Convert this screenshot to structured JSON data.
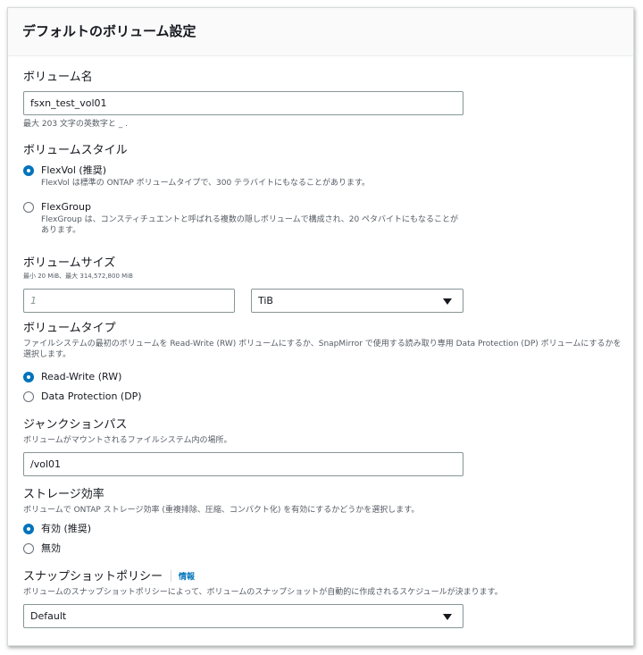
{
  "panel": {
    "title": "デフォルトのボリューム設定"
  },
  "volume_name": {
    "label": "ボリューム名",
    "value": "fsxn_test_vol01",
    "hint": "最大 203 文字の英数字と _ ."
  },
  "volume_style": {
    "label": "ボリュームスタイル",
    "options": [
      {
        "label": "FlexVol (推奨)",
        "description": "FlexVol は標準の ONTAP ボリュームタイプで、300 テラバイトにもなることがあります。",
        "selected": true
      },
      {
        "label": "FlexGroup",
        "description": "FlexGroup は、コンスティチュエントと呼ばれる複数の隠しボリュームで構成され、20 ペタバイトにもなることがあります。",
        "selected": false
      }
    ]
  },
  "volume_size": {
    "label": "ボリュームサイズ",
    "hint": "最小 20 MiB、最大 314,572,800 MiB",
    "placeholder": "1",
    "unit": "TiB"
  },
  "volume_type": {
    "label": "ボリュームタイプ",
    "description": "ファイルシステムの最初のボリュームを Read-Write (RW) ボリュームにするか、SnapMirror で使用する読み取り専用 Data Protection (DP) ボリュームにするかを選択します。",
    "options": [
      {
        "label": "Read-Write (RW)",
        "selected": true
      },
      {
        "label": "Data Protection (DP)",
        "selected": false
      }
    ]
  },
  "junction_path": {
    "label": "ジャンクションパス",
    "hint": "ボリュームがマウントされるファイルシステム内の場所。",
    "value": "/vol01"
  },
  "storage_efficiency": {
    "label": "ストレージ効率",
    "hint": "ボリュームで ONTAP ストレージ効率 (重複排除、圧縮、コンパクト化) を有効にするかどうかを選択します。",
    "options": [
      {
        "label": "有効 (推奨)",
        "selected": true
      },
      {
        "label": "無効",
        "selected": false
      }
    ]
  },
  "snapshot_policy": {
    "label": "スナップショットポリシー",
    "info_link": "情報",
    "hint": "ボリュームのスナップショットポリシーによって、ボリュームのスナップショットが自動的に作成されるスケジュールが決まります。",
    "value": "Default"
  }
}
